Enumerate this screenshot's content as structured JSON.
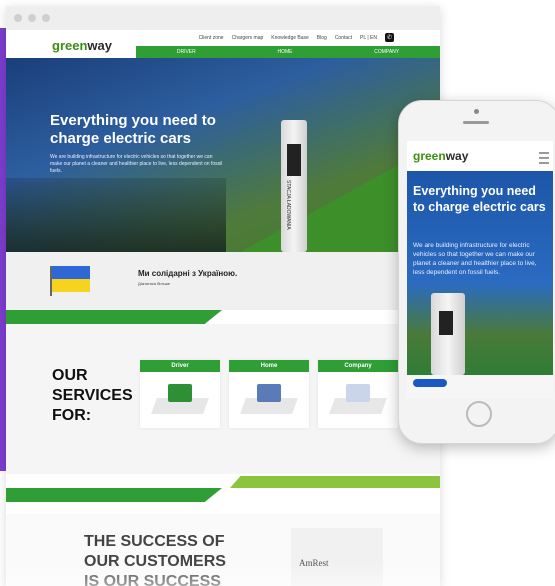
{
  "desktop": {
    "logo": {
      "green": "green",
      "dark": "way"
    },
    "top_nav": [
      "Client zone",
      "Chargers map",
      "Knowledge Base",
      "Blog",
      "Contact",
      "PL | EN"
    ],
    "main_nav": [
      "DRIVER",
      "HOME",
      "COMPANY"
    ],
    "hero": {
      "title": "Everything you need to charge electric cars",
      "subtitle": "We are building infrastructure for electric vehicles so that together we can make our planet a cleaner and healthier place to live, less dependent on fossil fuels.",
      "station_label": "STACJA ŁADOWANIA"
    },
    "ukraine": {
      "title": "Ми солідарні з Україною.",
      "link": "Дізнатися більше"
    },
    "services": {
      "title": "OUR SERVICES FOR:",
      "cards": [
        {
          "label": "Driver",
          "icon": "cars-charging-icon"
        },
        {
          "label": "Home",
          "icon": "house-car-icon"
        },
        {
          "label": "Company",
          "icon": "office-building-icon"
        }
      ]
    },
    "success": {
      "title": "THE SUCCESS OF OUR CUSTOMERS IS OUR SUCCESS",
      "partner": "AmRest"
    }
  },
  "mobile": {
    "logo": {
      "green": "green",
      "dark": "way"
    },
    "hero_title": "Everything you need to charge electric cars",
    "hero_subtitle": "We are building infrastructure for electric vehicles so that together we can make our planet a cleaner and healthier place to live, less dependent on fossil fuels."
  },
  "colors": {
    "brand_green": "#2e9e35",
    "light_green": "#8ac53d",
    "accent_purple": "#7d3ccf",
    "hero_blue": "#2b6bc1"
  }
}
